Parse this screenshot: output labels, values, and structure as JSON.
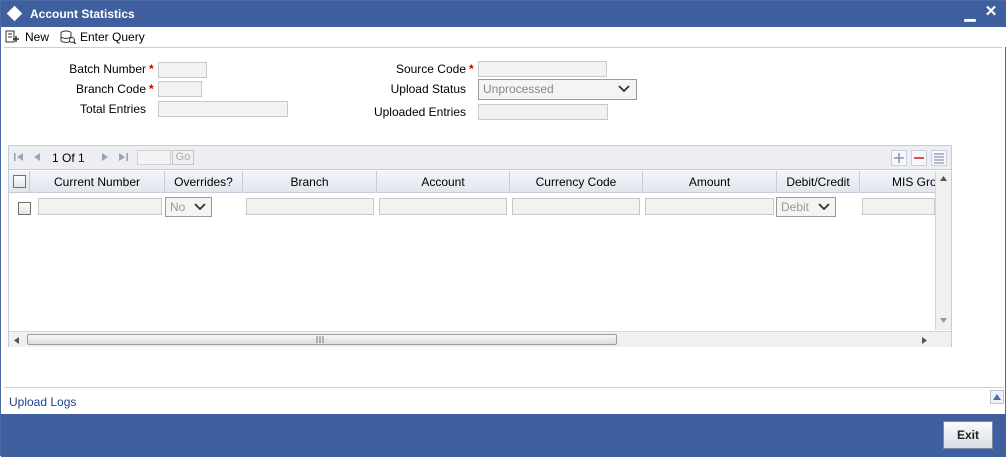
{
  "window": {
    "title": "Account Statistics"
  },
  "toolbar": {
    "new_label": "New",
    "enter_query_label": "Enter Query"
  },
  "form": {
    "batch_number_label": "Batch Number",
    "branch_code_label": "Branch Code",
    "total_entries_label": "Total Entries",
    "source_code_label": "Source Code",
    "upload_status_label": "Upload Status",
    "upload_status_value": "Unprocessed",
    "uploaded_entries_label": "Uploaded Entries",
    "required_mark": "*"
  },
  "grid": {
    "pager_text": "1 Of 1",
    "go_label": "Go",
    "columns": [
      "Current Number",
      "Overrides?",
      "Branch",
      "Account",
      "Currency Code",
      "Amount",
      "Debit/Credit",
      "MIS Gro"
    ],
    "row": {
      "overrides_value": "No",
      "debit_credit_value": "Debit"
    }
  },
  "footer": {
    "upload_logs_label": "Upload Logs",
    "exit_label": "Exit"
  },
  "colors": {
    "titlebar": "#3f5f9e",
    "required": "#cc0000",
    "link": "#1f3f8f"
  }
}
